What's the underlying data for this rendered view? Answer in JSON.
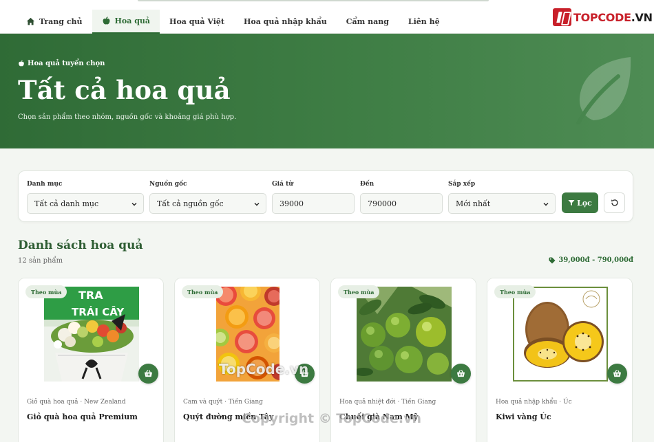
{
  "nav": {
    "items": [
      {
        "label": "Trang chủ",
        "icon": "home-icon"
      },
      {
        "label": "Hoa quả",
        "icon": "apple-icon"
      },
      {
        "label": "Hoa quả Việt"
      },
      {
        "label": "Hoa quả nhập khẩu"
      },
      {
        "label": "Cẩm nang"
      },
      {
        "label": "Liên hệ"
      }
    ],
    "active_index": 1
  },
  "logo": {
    "prefix": "TOPCODE",
    "suffix": ".VN"
  },
  "hero": {
    "eyebrow": "Hoa quả tuyển chọn",
    "title": "Tất cả hoa quả",
    "subtitle": "Chọn sản phẩm theo nhóm, nguồn gốc và khoảng giá phù hợp."
  },
  "filter": {
    "category_label": "Danh mục",
    "category_value": "Tất cả danh mục",
    "origin_label": "Nguồn gốc",
    "origin_value": "Tất cả nguồn gốc",
    "price_from_label": "Giá từ",
    "price_from_value": "39000",
    "price_to_label": "Đến",
    "price_to_value": "790000",
    "sort_label": "Sắp xếp",
    "sort_value": "Mới nhất",
    "submit_label": "Lọc"
  },
  "list": {
    "title": "Danh sách hoa quả",
    "count": "12 sản phẩm",
    "price_range": "39,000đ - 790,000đ"
  },
  "products": [
    {
      "tag": "Theo mùa",
      "category": "Giỏ quà hoa quả",
      "origin": "New Zealand",
      "name": "Giỏ quà hoa quả Premium",
      "photo": "gift-basket-photo"
    },
    {
      "tag": "Theo mùa",
      "category": "Cam và quýt",
      "origin": "Tiền Giang",
      "name": "Quýt đường miền Tây",
      "photo": "citrus-slices-photo"
    },
    {
      "tag": "Theo mùa",
      "category": "Hoa quả nhiệt đới",
      "origin": "Tiền Giang",
      "name": "Chuối già Nam Mỹ",
      "photo": "green-citrus-tree-photo"
    },
    {
      "tag": "Theo mùa",
      "category": "Hoa quả nhập khẩu",
      "origin": "Úc",
      "name": "Kiwi vàng Úc",
      "photo": "golden-kiwi-photo"
    }
  ],
  "watermarks": {
    "overlay": "TopCode.vn",
    "copyright": "Copyright © TopCode.vn"
  },
  "colors": {
    "primary": "#3c7a41",
    "hero": "#2f6b36",
    "logo_red": "#c8202a"
  }
}
